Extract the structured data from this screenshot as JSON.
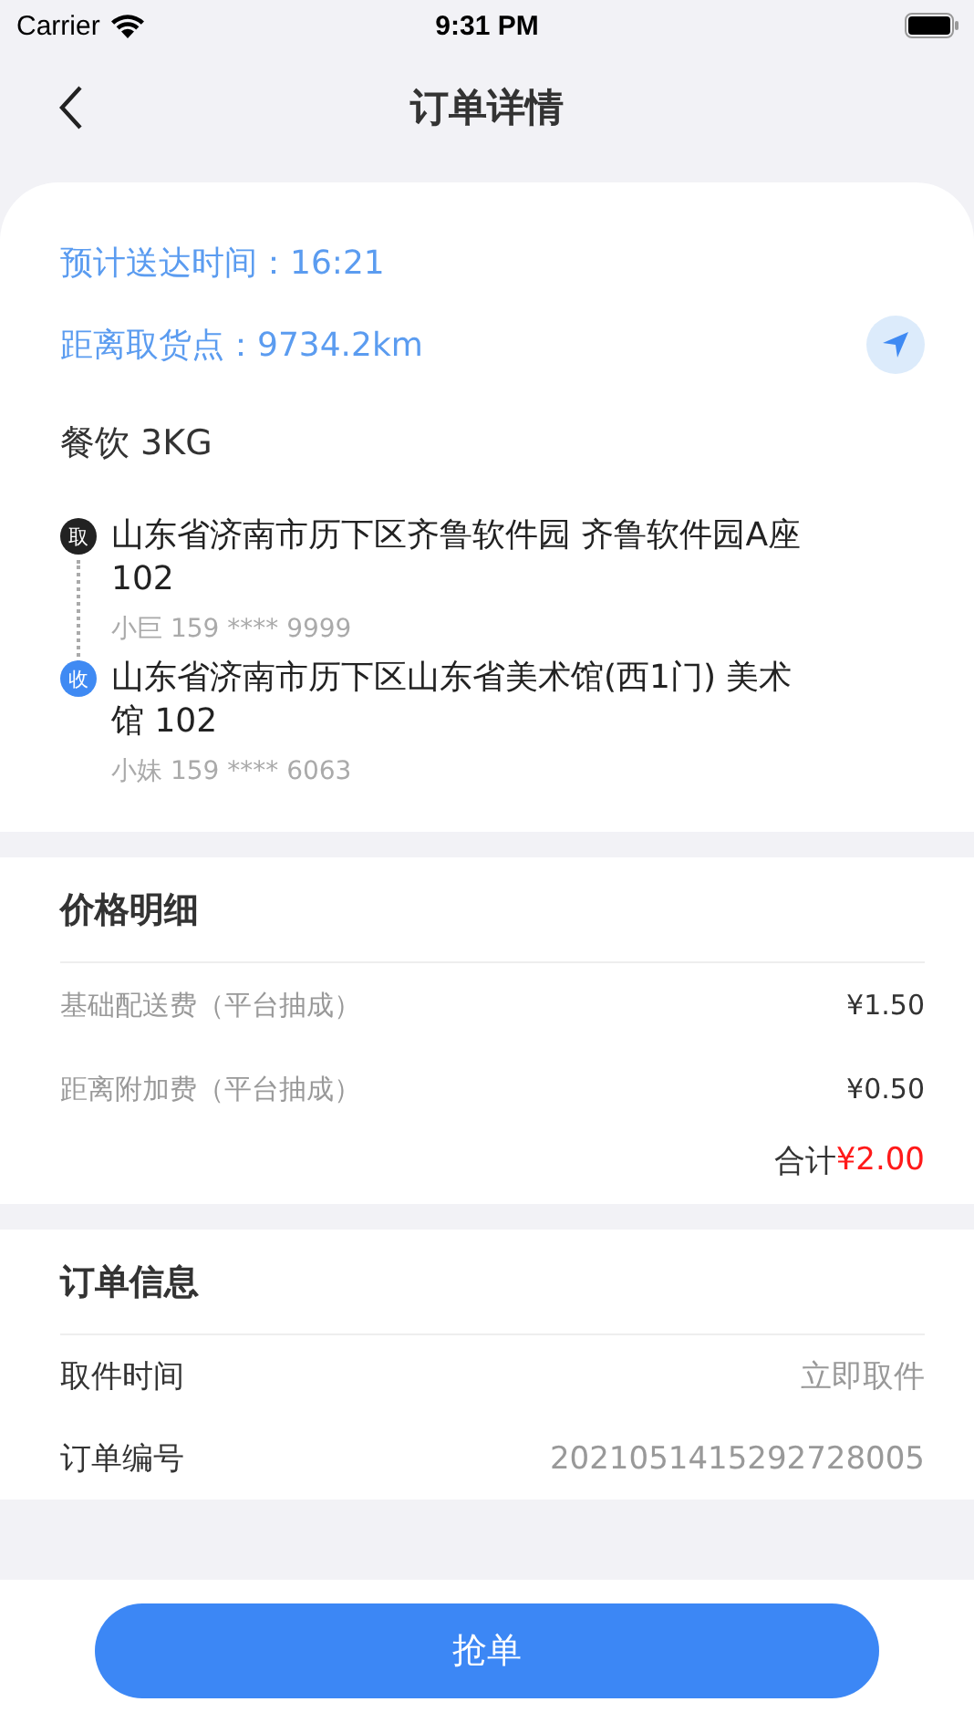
{
  "status_bar": {
    "carrier": "Carrier",
    "time": "9:31 PM"
  },
  "nav": {
    "title": "订单详情"
  },
  "summary": {
    "eta": "预计送达时间：16:21",
    "distance": "距离取货点：9734.2km",
    "goods": "餐饮 3KG",
    "stops": [
      {
        "kind": "pickup",
        "badge": "取",
        "address": "山东省济南市历下区齐鲁软件园 齐鲁软件园A座 102",
        "contact": "小巨  159 **** 9999"
      },
      {
        "kind": "dropoff",
        "badge": "收",
        "address": "山东省济南市历下区山东省美术馆(西1门) 美术馆 102",
        "contact": "小妹  159 **** 6063"
      }
    ]
  },
  "price": {
    "title": "价格明细",
    "items": [
      {
        "label": "基础配送费（平台抽成）",
        "value": "¥1.50"
      },
      {
        "label": "距离附加费（平台抽成）",
        "value": "¥0.50"
      }
    ],
    "total_label": "合计",
    "total": "¥2.00"
  },
  "order_info": {
    "title": "订单信息",
    "rows": [
      {
        "label": "取件时间",
        "value": "立即取件"
      },
      {
        "label": "订单编号",
        "value": "2021051415292728005"
      }
    ]
  },
  "action_button": "抢单"
}
